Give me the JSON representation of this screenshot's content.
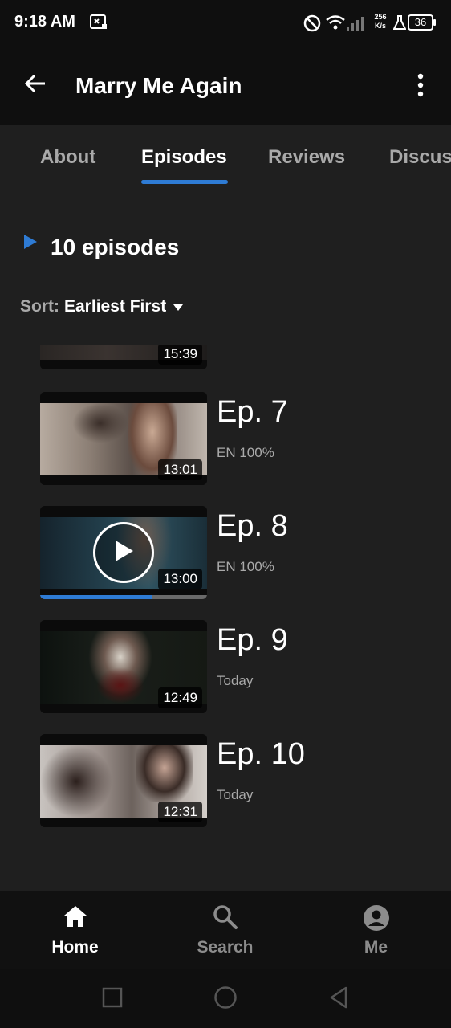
{
  "status_bar": {
    "time": "9:18 AM",
    "speed_top": "256",
    "speed_bottom": "K/s",
    "battery": "36",
    "icons": [
      "screenshot-icon",
      "do-not-disturb-icon",
      "wifi-icon",
      "signal-icon",
      "flask-icon",
      "battery-icon"
    ]
  },
  "app_bar": {
    "title": "Marry Me Again",
    "icons": [
      "back-arrow-icon",
      "more-vert-icon"
    ]
  },
  "tabs": [
    {
      "label": "About",
      "active": false
    },
    {
      "label": "Episodes",
      "active": true
    },
    {
      "label": "Reviews",
      "active": false
    },
    {
      "label": "Discus",
      "active": false
    }
  ],
  "episodes_section": {
    "count_label": "10 episodes",
    "sort_label": "Sort:",
    "sort_value": "Earliest First"
  },
  "episodes": [
    {
      "title": "",
      "subtitle": "",
      "duration": "15:39"
    },
    {
      "title": "Ep. 7",
      "subtitle": "EN 100%",
      "duration": "13:01"
    },
    {
      "title": "Ep. 8",
      "subtitle": "EN 100%",
      "duration": "13:00",
      "progress": 0.67,
      "playing": true
    },
    {
      "title": "Ep. 9",
      "subtitle": "Today",
      "duration": "12:49"
    },
    {
      "title": "Ep. 10",
      "subtitle": "Today",
      "duration": "12:31"
    }
  ],
  "bottom_nav": [
    {
      "label": "Home",
      "icon": "home-icon",
      "active": true
    },
    {
      "label": "Search",
      "icon": "search-icon",
      "active": false
    },
    {
      "label": "Me",
      "icon": "account-icon",
      "active": false
    }
  ],
  "colors": {
    "accent": "#2e7bd4",
    "background": "#1f1f1f",
    "bar": "#0f0f0f"
  }
}
